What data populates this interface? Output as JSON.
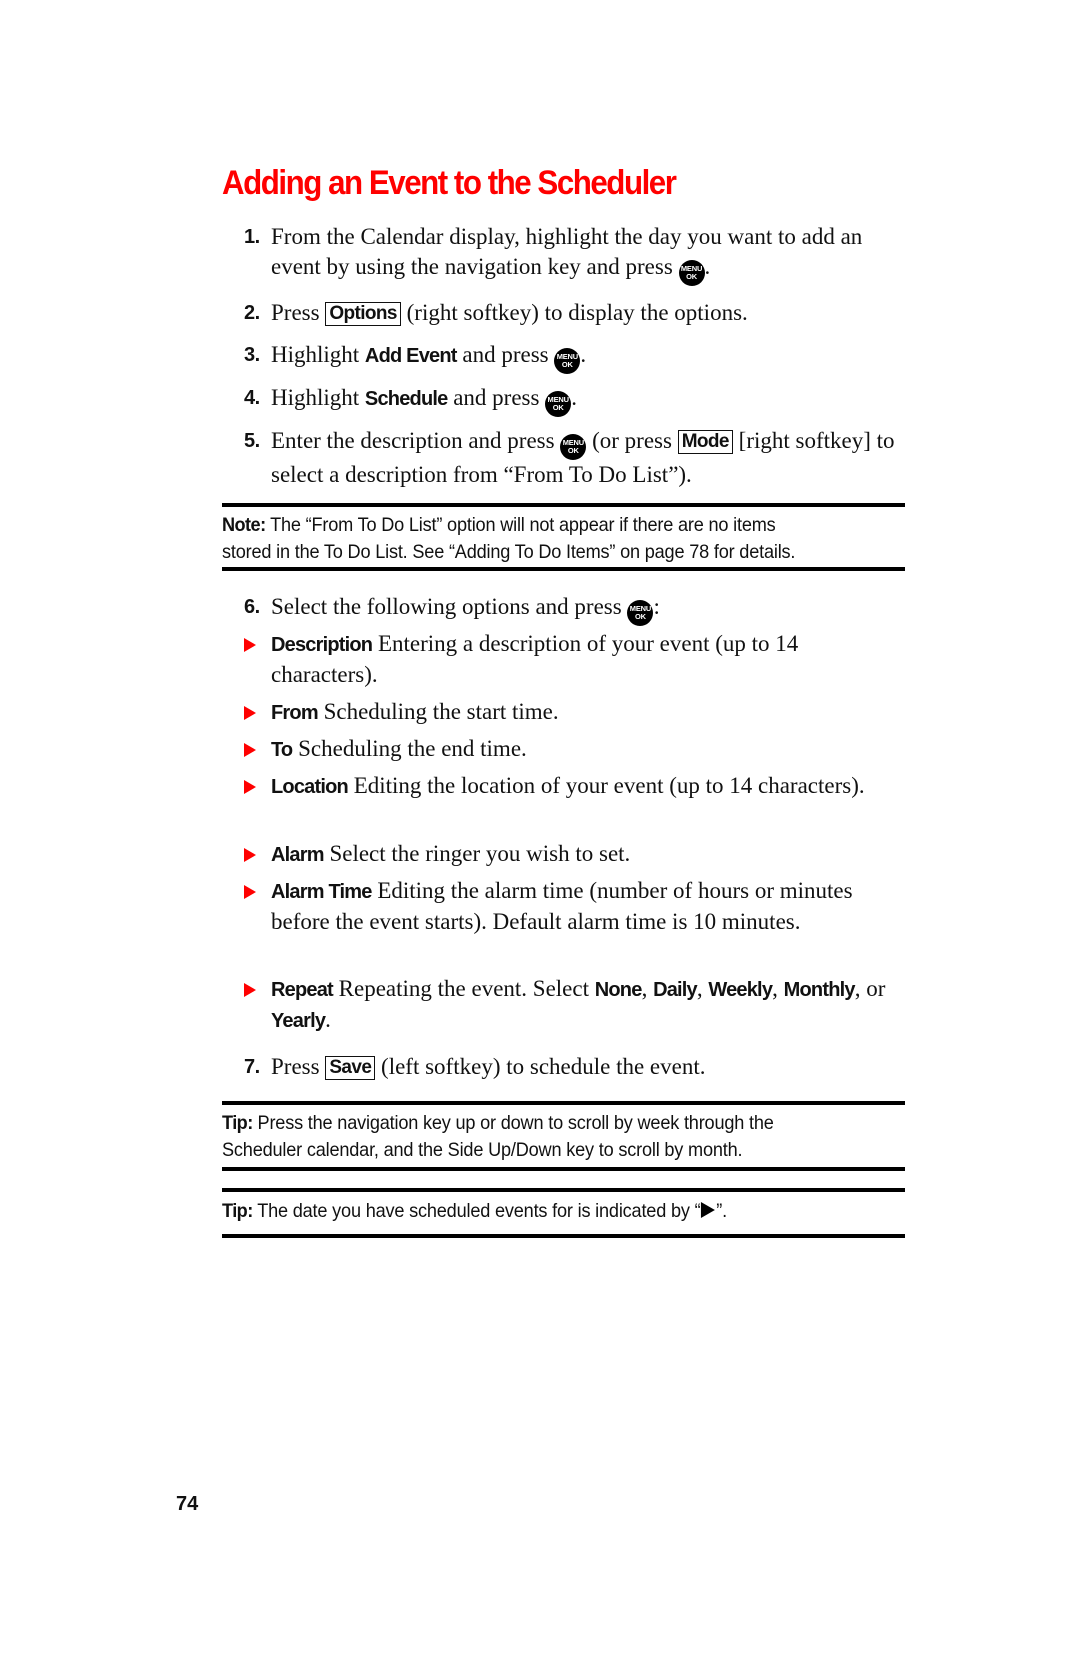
{
  "title": "Adding an Event to the Scheduler",
  "key_icon": {
    "name": "menu-ok-key",
    "line1": "MENU",
    "line2": "OK"
  },
  "steps": [
    {
      "num": "1.",
      "text_a": "From the Calendar display, highlight the day you want to add an event by using the navigation key and press",
      "text_b": "."
    },
    {
      "num": "2.",
      "text_a": "Press",
      "key": "Options",
      "text_b": "(right softkey) to display the options."
    },
    {
      "num": "3.",
      "text_a": "Highlight",
      "bold": "Add Event",
      "text_b": "and press",
      "text_c": "."
    },
    {
      "num": "4.",
      "text_a": "Highlight",
      "bold": "Schedule",
      "text_b": "and press",
      "text_c": "."
    },
    {
      "num": "5.",
      "text_a": "Enter the description and press",
      "text_b": "(or press",
      "key": "Mode",
      "text_c": "[right softkey] to select a description from “From To Do List”)."
    },
    {
      "num": "6.",
      "text_a": "Select the following options and press",
      "text_b": ":"
    },
    {
      "num": "7.",
      "text_a": "Press",
      "key": "Save",
      "text_b": "(left softkey) to schedule the event."
    }
  ],
  "note": {
    "label": "Note:",
    "line1": "The “From To Do List” option will not appear if there are no items",
    "line2": "stored in the To Do List. See “Adding To Do Items” on page 78 for details."
  },
  "options": [
    {
      "term": "Description",
      "desc": "Entering a description of your event (up to 14 characters)."
    },
    {
      "term": "From",
      "desc": "Scheduling the start time."
    },
    {
      "term": "To",
      "desc": "Scheduling the end time."
    },
    {
      "term": "Location",
      "desc": "Editing the location of your event (up to 14 characters)."
    },
    {
      "term": "Alarm",
      "desc": "Select the ringer you wish to set."
    },
    {
      "term": "Alarm Time",
      "desc": "Editing the alarm time (number of hours or minutes before the event starts). Default alarm time is 10 minutes."
    },
    {
      "term": "Repeat",
      "desc": "Repeating the event. Select",
      "choices": [
        "None",
        "Daily",
        "Weekly",
        "Monthly",
        "Yearly"
      ],
      "sep1": ",",
      "sep2": ", or",
      "end": "."
    }
  ],
  "tips": [
    {
      "label": "Tip:",
      "line1": "Press the navigation key up or down to scroll by week through the",
      "line2": "Scheduler calendar, and the Side Up/Down key to scroll by month."
    },
    {
      "label": "Tip:",
      "text_a": "The date you have scheduled events for is indicated by “",
      "text_b": "”."
    }
  ],
  "page_number": "74",
  "colors": {
    "accent": "#ff0000",
    "text": "#111111"
  }
}
